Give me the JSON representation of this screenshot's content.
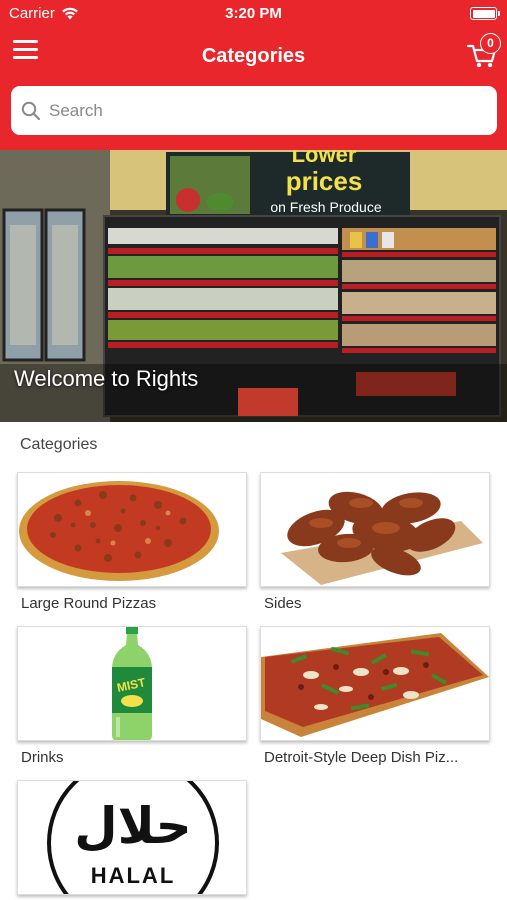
{
  "status_bar": {
    "carrier": "Carrier",
    "time": "3:20 PM"
  },
  "header": {
    "title": "Categories",
    "cart_count": "0"
  },
  "search": {
    "placeholder": "Search"
  },
  "banner": {
    "title": "Welcome to Rights",
    "sign_line1": "Lower",
    "sign_line2": "prices",
    "sign_line3": "on Fresh Produce"
  },
  "section": {
    "title": "Categories"
  },
  "categories": [
    {
      "label": "Large Round Pizzas",
      "icon": "pizza-image"
    },
    {
      "label": "Sides",
      "icon": "chicken-wings-image"
    },
    {
      "label": "Drinks",
      "icon": "soda-bottle-image",
      "bottle_text": "MIST"
    },
    {
      "label": "Detroit-Style Deep Dish Piz...",
      "icon": "deep-dish-pizza-image"
    },
    {
      "label": "",
      "icon": "halal-logo",
      "logo_text": "HALAL",
      "logo_script": "حلال"
    }
  ],
  "colors": {
    "brand_red": "#e8262b",
    "white": "#ffffff"
  }
}
